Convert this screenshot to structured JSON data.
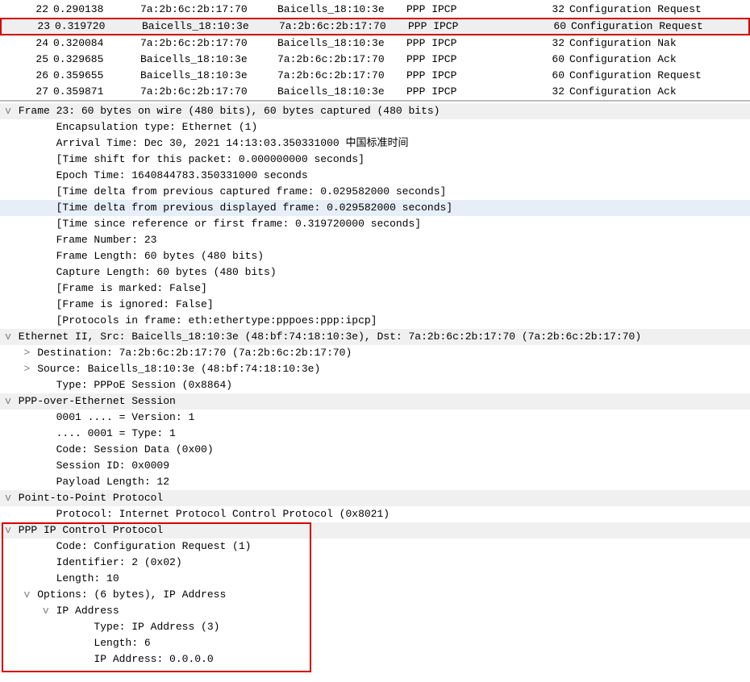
{
  "packets": [
    {
      "no": "22",
      "time": "0.290138",
      "src": "7a:2b:6c:2b:17:70",
      "dst": "Baicells_18:10:3e",
      "proto": "PPP IPCP",
      "len": "32",
      "info": "Configuration Request"
    },
    {
      "no": "23",
      "time": "0.319720",
      "src": "Baicells_18:10:3e",
      "dst": "7a:2b:6c:2b:17:70",
      "proto": "PPP IPCP",
      "len": "60",
      "info": "Configuration Request",
      "highlight": true
    },
    {
      "no": "24",
      "time": "0.320084",
      "src": "7a:2b:6c:2b:17:70",
      "dst": "Baicells_18:10:3e",
      "proto": "PPP IPCP",
      "len": "32",
      "info": "Configuration Nak"
    },
    {
      "no": "25",
      "time": "0.329685",
      "src": "Baicells_18:10:3e",
      "dst": "7a:2b:6c:2b:17:70",
      "proto": "PPP IPCP",
      "len": "60",
      "info": "Configuration Ack"
    },
    {
      "no": "26",
      "time": "0.359655",
      "src": "Baicells_18:10:3e",
      "dst": "7a:2b:6c:2b:17:70",
      "proto": "PPP IPCP",
      "len": "60",
      "info": "Configuration Request"
    },
    {
      "no": "27",
      "time": "0.359871",
      "src": "7a:2b:6c:2b:17:70",
      "dst": "Baicells_18:10:3e",
      "proto": "PPP IPCP",
      "len": "32",
      "info": "Configuration Ack"
    }
  ],
  "details": [
    {
      "indent": 0,
      "chev": "v",
      "text": "Frame 23: 60 bytes on wire (480 bits), 60 bytes captured (480 bits)",
      "header": true
    },
    {
      "indent": 2,
      "chev": "",
      "text": "Encapsulation type: Ethernet (1)"
    },
    {
      "indent": 2,
      "chev": "",
      "text": "Arrival Time: Dec 30, 2021 14:13:03.350331000 中国标准时间"
    },
    {
      "indent": 2,
      "chev": "",
      "text": "[Time shift for this packet: 0.000000000 seconds]"
    },
    {
      "indent": 2,
      "chev": "",
      "text": "Epoch Time: 1640844783.350331000 seconds"
    },
    {
      "indent": 2,
      "chev": "",
      "text": "[Time delta from previous captured frame: 0.029582000 seconds]"
    },
    {
      "indent": 2,
      "chev": "",
      "text": "[Time delta from previous displayed frame: 0.029582000 seconds]",
      "sel": true
    },
    {
      "indent": 2,
      "chev": "",
      "text": "[Time since reference or first frame: 0.319720000 seconds]"
    },
    {
      "indent": 2,
      "chev": "",
      "text": "Frame Number: 23"
    },
    {
      "indent": 2,
      "chev": "",
      "text": "Frame Length: 60 bytes (480 bits)"
    },
    {
      "indent": 2,
      "chev": "",
      "text": "Capture Length: 60 bytes (480 bits)"
    },
    {
      "indent": 2,
      "chev": "",
      "text": "[Frame is marked: False]"
    },
    {
      "indent": 2,
      "chev": "",
      "text": "[Frame is ignored: False]"
    },
    {
      "indent": 2,
      "chev": "",
      "text": "[Protocols in frame: eth:ethertype:pppoes:ppp:ipcp]"
    },
    {
      "indent": 0,
      "chev": "v",
      "text": "Ethernet II, Src: Baicells_18:10:3e (48:bf:74:18:10:3e), Dst: 7a:2b:6c:2b:17:70 (7a:2b:6c:2b:17:70)",
      "header": true
    },
    {
      "indent": 1,
      "chev": ">",
      "text": "Destination: 7a:2b:6c:2b:17:70 (7a:2b:6c:2b:17:70)"
    },
    {
      "indent": 1,
      "chev": ">",
      "text": "Source: Baicells_18:10:3e (48:bf:74:18:10:3e)"
    },
    {
      "indent": 2,
      "chev": "",
      "text": "Type: PPPoE Session (0x8864)"
    },
    {
      "indent": 0,
      "chev": "v",
      "text": "PPP-over-Ethernet Session",
      "header": true
    },
    {
      "indent": 2,
      "chev": "",
      "text": "0001 .... = Version: 1"
    },
    {
      "indent": 2,
      "chev": "",
      "text": ".... 0001 = Type: 1"
    },
    {
      "indent": 2,
      "chev": "",
      "text": "Code: Session Data (0x00)"
    },
    {
      "indent": 2,
      "chev": "",
      "text": "Session ID: 0x0009"
    },
    {
      "indent": 2,
      "chev": "",
      "text": "Payload Length: 12"
    },
    {
      "indent": 0,
      "chev": "v",
      "text": "Point-to-Point Protocol",
      "header": true
    },
    {
      "indent": 2,
      "chev": "",
      "text": "Protocol: Internet Protocol Control Protocol (0x8021)"
    },
    {
      "indent": 0,
      "chev": "v",
      "text": "PPP IP Control Protocol",
      "header": true
    },
    {
      "indent": 2,
      "chev": "",
      "text": "Code: Configuration Request (1)"
    },
    {
      "indent": 2,
      "chev": "",
      "text": "Identifier: 2 (0x02)"
    },
    {
      "indent": 2,
      "chev": "",
      "text": "Length: 10"
    },
    {
      "indent": 1,
      "chev": "v",
      "text": "Options: (6 bytes), IP Address"
    },
    {
      "indent": 2,
      "chev": "v",
      "text": "IP Address"
    },
    {
      "indent": 4,
      "chev": "",
      "text": "Type: IP Address (3)"
    },
    {
      "indent": 4,
      "chev": "",
      "text": "Length: 6"
    },
    {
      "indent": 4,
      "chev": "",
      "text": "IP Address: 0.0.0.0"
    }
  ]
}
